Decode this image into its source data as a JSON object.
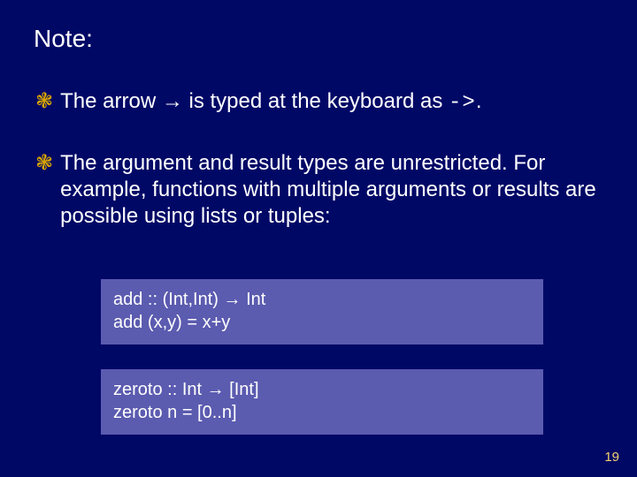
{
  "slide": {
    "heading": "Note:",
    "bullets": [
      {
        "seg_a": "The arrow ",
        "arrow": "®",
        "seg_b": " is typed at the keyboard as ",
        "mono": "->",
        "seg_c": "."
      },
      {
        "seg_a": "The argument and result types are unrestricted. For example, functions with multiple arguments or results are possible using lists or tuples:",
        "arrow": "",
        "seg_b": "",
        "mono": "",
        "seg_c": ""
      }
    ],
    "bullet_glyph": "❃",
    "arrow_glyph": "→",
    "code1": {
      "l1a": "add        :: (Int,Int) ",
      "l1b": " Int",
      "l2": "add (x,y) = x+y"
    },
    "code2": {
      "l1a": "zeroto    :: Int ",
      "l1b": " [Int]",
      "l2": "zeroto n  = [0..n]"
    },
    "page_number": "19"
  }
}
